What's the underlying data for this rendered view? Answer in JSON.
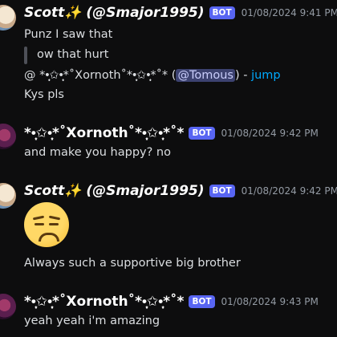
{
  "messages": [
    {
      "user": "Scott✨ (@Smajor1995)",
      "badge": "BOT",
      "timestamp": "01/08/2024 9:41 PM",
      "lines": [
        "Punz I saw that"
      ],
      "quote": "ow that hurt",
      "reply_prefix": "@ *•̩̩͙✩•̩̩͙*˚Xornoth˚*•̩̩͙✩•̩̩͙*˚* (",
      "reply_mention": "@Tomous",
      "reply_suffix": ") - ",
      "reply_link": "jump",
      "last_line": "Kys pls"
    },
    {
      "user": "*•̩̩͙✩•̩̩͙*˚Xornoth˚*•̩̩͙✩•̩̩͙*˚*",
      "badge": "BOT",
      "timestamp": "01/08/2024 9:42 PM",
      "text": "and make you happy? no"
    },
    {
      "user": "Scott✨ (@Smajor1995)",
      "badge": "BOT",
      "timestamp": "01/08/2024 9:42 PM",
      "emoji": "unamused-face",
      "text": "Always such a supportive big brother"
    },
    {
      "user": "*•̩̩͙✩•̩̩͙*˚Xornoth˚*•̩̩͙✩•̩̩͙*˚*",
      "badge": "BOT",
      "timestamp": "01/08/2024 9:43 PM",
      "text": "yeah yeah i'm amazing"
    }
  ],
  "colors": {
    "background": "#0d0d0e",
    "bot_badge": "#5865f2",
    "link": "#00a8fc",
    "mention_bg": "#3c4270"
  }
}
